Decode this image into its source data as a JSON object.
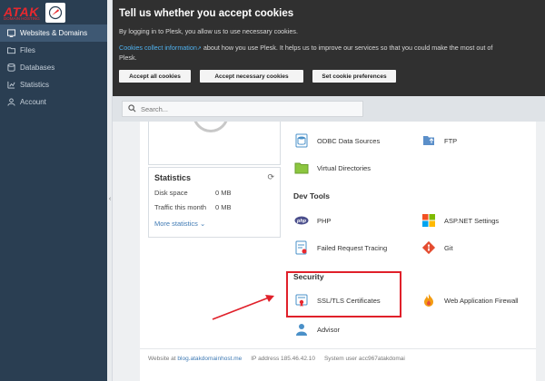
{
  "logo": {
    "text": "ATAK",
    "subtitle": "DOMAIN HOSTING"
  },
  "sidebar": {
    "items": [
      {
        "label": "Websites & Domains",
        "icon": "globe-icon",
        "active": true
      },
      {
        "label": "Files",
        "icon": "folder-icon"
      },
      {
        "label": "Databases",
        "icon": "database-icon"
      },
      {
        "label": "Statistics",
        "icon": "chart-icon"
      },
      {
        "label": "Account",
        "icon": "user-icon"
      }
    ]
  },
  "cookie": {
    "title": "Tell us whether you accept cookies",
    "line1": "By logging in to Plesk, you allow us to use necessary cookies.",
    "link": "Cookies collect information",
    "line2_rest": " about how you use Plesk. It helps us to improve our services so that you could make the most out of Plesk.",
    "buttons": {
      "accept_all": "Accept all cookies",
      "accept_necessary": "Accept necessary cookies",
      "preferences": "Set cookie preferences"
    }
  },
  "search": {
    "placeholder": "Search..."
  },
  "statistics": {
    "title": "Statistics",
    "rows": [
      {
        "label": "Disk space",
        "value": "0 MB"
      },
      {
        "label": "Traffic this month",
        "value": "0 MB"
      }
    ],
    "more": "More statistics"
  },
  "tools": {
    "odbc": "ODBC Data Sources",
    "ftp": "FTP",
    "virtual_dirs": "Virtual Directories",
    "dev_tools_title": "Dev Tools",
    "php": "PHP",
    "aspnet": "ASP.NET Settings",
    "failed_tracing": "Failed Request Tracing",
    "git": "Git",
    "security_title": "Security",
    "ssl": "SSL/TLS Certificates",
    "waf": "Web Application Firewall",
    "advisor": "Advisor"
  },
  "footer": {
    "website_label": "Website at",
    "website": "blog.atakdomainhost.me",
    "ip_label": "IP address",
    "ip": "185.46.42.10",
    "user_label": "System user",
    "user": "acc967atakdomai"
  },
  "colors": {
    "sidebar": "#2a3e52",
    "highlight": "#e0202a",
    "link": "#3f7ab4"
  }
}
